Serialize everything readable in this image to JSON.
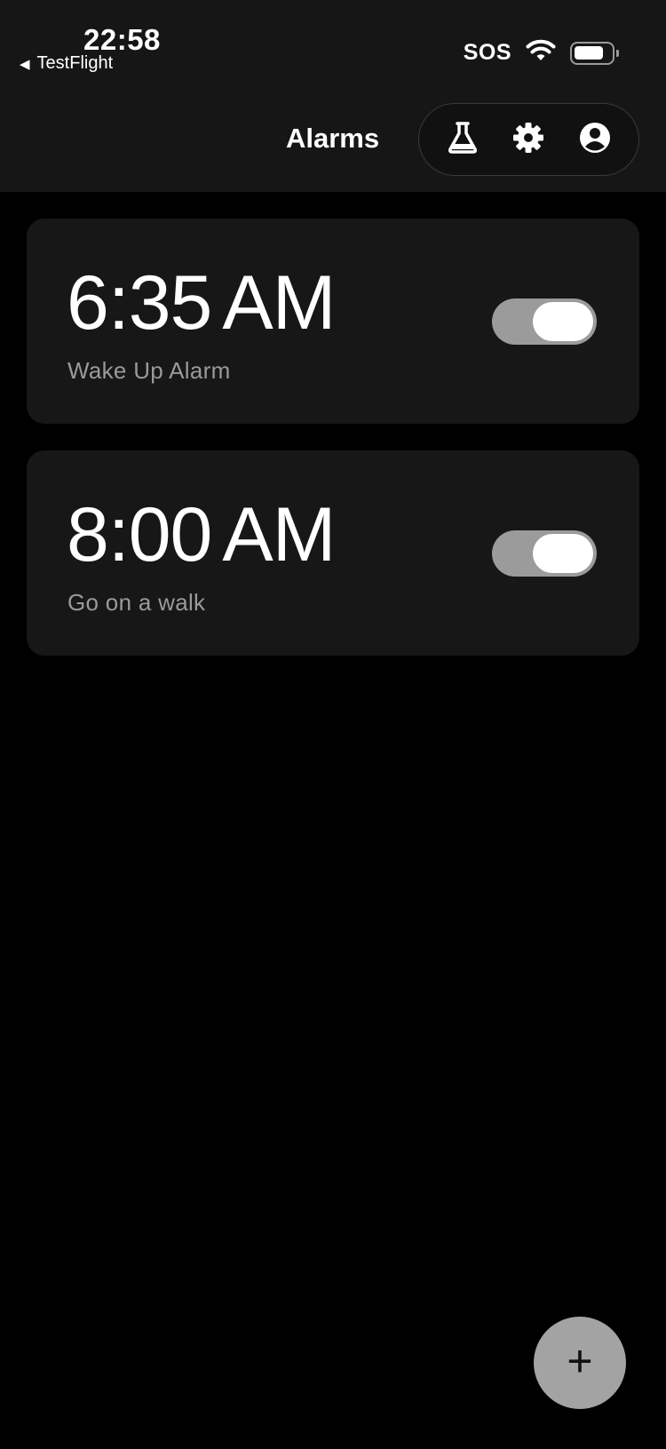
{
  "status_bar": {
    "time": "22:58",
    "back_app": "TestFlight",
    "carrier": "SOS",
    "battery_level": 0.8
  },
  "nav": {
    "title": "Alarms",
    "actions": [
      {
        "name": "labs",
        "icon": "flask-icon"
      },
      {
        "name": "settings",
        "icon": "gear-icon"
      },
      {
        "name": "account",
        "icon": "account-circle-icon"
      }
    ]
  },
  "alarms": [
    {
      "time": "6:35",
      "ampm": "AM",
      "label": "Wake Up Alarm",
      "enabled": true
    },
    {
      "time": "8:00",
      "ampm": "AM",
      "label": "Go on a walk",
      "enabled": true
    }
  ],
  "fab": {
    "label": "+",
    "icon": "plus-icon"
  },
  "colors": {
    "background": "#000000",
    "topbar": "#161616",
    "card": "#171717",
    "toggle_track": "#9b9b9b",
    "fab": "#a3a3a3",
    "secondary_text": "#9a9a9a"
  }
}
